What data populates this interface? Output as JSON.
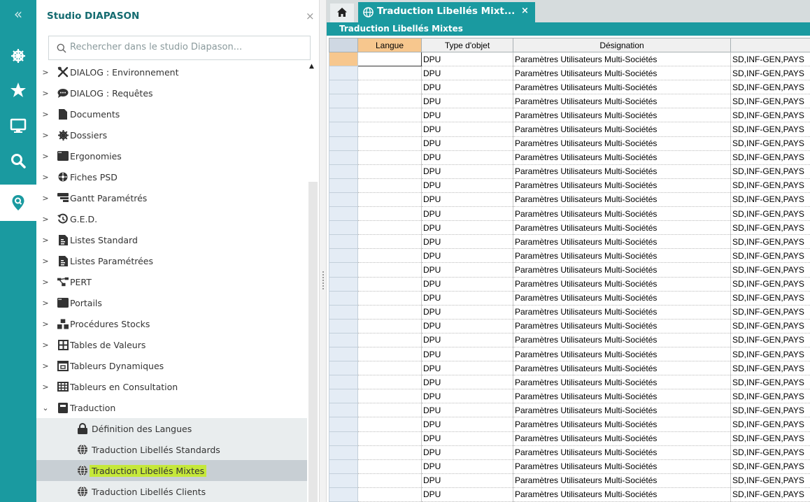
{
  "rail": {
    "collapse_glyph": "«",
    "items": [
      {
        "name": "ship-wheel-icon"
      },
      {
        "name": "star-icon"
      },
      {
        "name": "monitor-icon"
      },
      {
        "name": "search-icon"
      },
      {
        "name": "map-search-icon"
      }
    ]
  },
  "panel": {
    "title": "Studio DIAPASON",
    "close_glyph": "×",
    "search_placeholder": "Rechercher dans le studio Diapason..."
  },
  "tree": {
    "items": [
      {
        "label": "DIALOG : Environnement",
        "icon": "tools-icon"
      },
      {
        "label": "DIALOG : Requêtes",
        "icon": "chat-bubble-icon"
      },
      {
        "label": "Documents",
        "icon": "document-icon"
      },
      {
        "label": "Dossiers",
        "icon": "gear-wheel-icon"
      },
      {
        "label": "Ergonomies",
        "icon": "window-icon"
      },
      {
        "label": "Fiches PSD",
        "icon": "wheel-icon"
      },
      {
        "label": "Gantt Paramétrés",
        "icon": "gantt-icon"
      },
      {
        "label": "G.E.D.",
        "icon": "history-icon"
      },
      {
        "label": "Listes Standard",
        "icon": "list-doc-icon"
      },
      {
        "label": "Listes Paramétrées",
        "icon": "list-doc-icon"
      },
      {
        "label": "PERT",
        "icon": "network-icon"
      },
      {
        "label": "Portails",
        "icon": "window-icon"
      },
      {
        "label": "Procédures Stocks",
        "icon": "boxes-icon"
      },
      {
        "label": "Tables de Valeurs",
        "icon": "table-icon"
      },
      {
        "label": "Tableurs Dynamiques",
        "icon": "spreadsheet-icon"
      },
      {
        "label": "Tableurs en Consultation",
        "icon": "grid-icon"
      },
      {
        "label": "Traduction",
        "icon": "book-icon"
      }
    ],
    "children": [
      {
        "label": "Définition des Langues",
        "icon": "lock-icon"
      },
      {
        "label": "Traduction Libellés Standards",
        "icon": "globe-icon"
      },
      {
        "label": "Traduction Libellés Mixtes",
        "icon": "globe-icon"
      },
      {
        "label": "Traduction Libellés Clients",
        "icon": "globe-icon"
      }
    ]
  },
  "tab": {
    "label": "Traduction Libellés Mixt...",
    "close_glyph": "×"
  },
  "subheader": "Traduction Libellés Mixtes",
  "grid": {
    "headers": [
      "Langue",
      "Type d'objet",
      "Désignation",
      ""
    ],
    "row_type": "DPU",
    "row_designation": "Paramètres Utilisateurs Multi-Sociétés",
    "row_code": "SD,INF-GEN,PAYS",
    "row_count": 32
  },
  "colors": {
    "teal": "#1a9aa0",
    "highlight": "#c5e83a",
    "sorted_header": "#f7c78e"
  }
}
